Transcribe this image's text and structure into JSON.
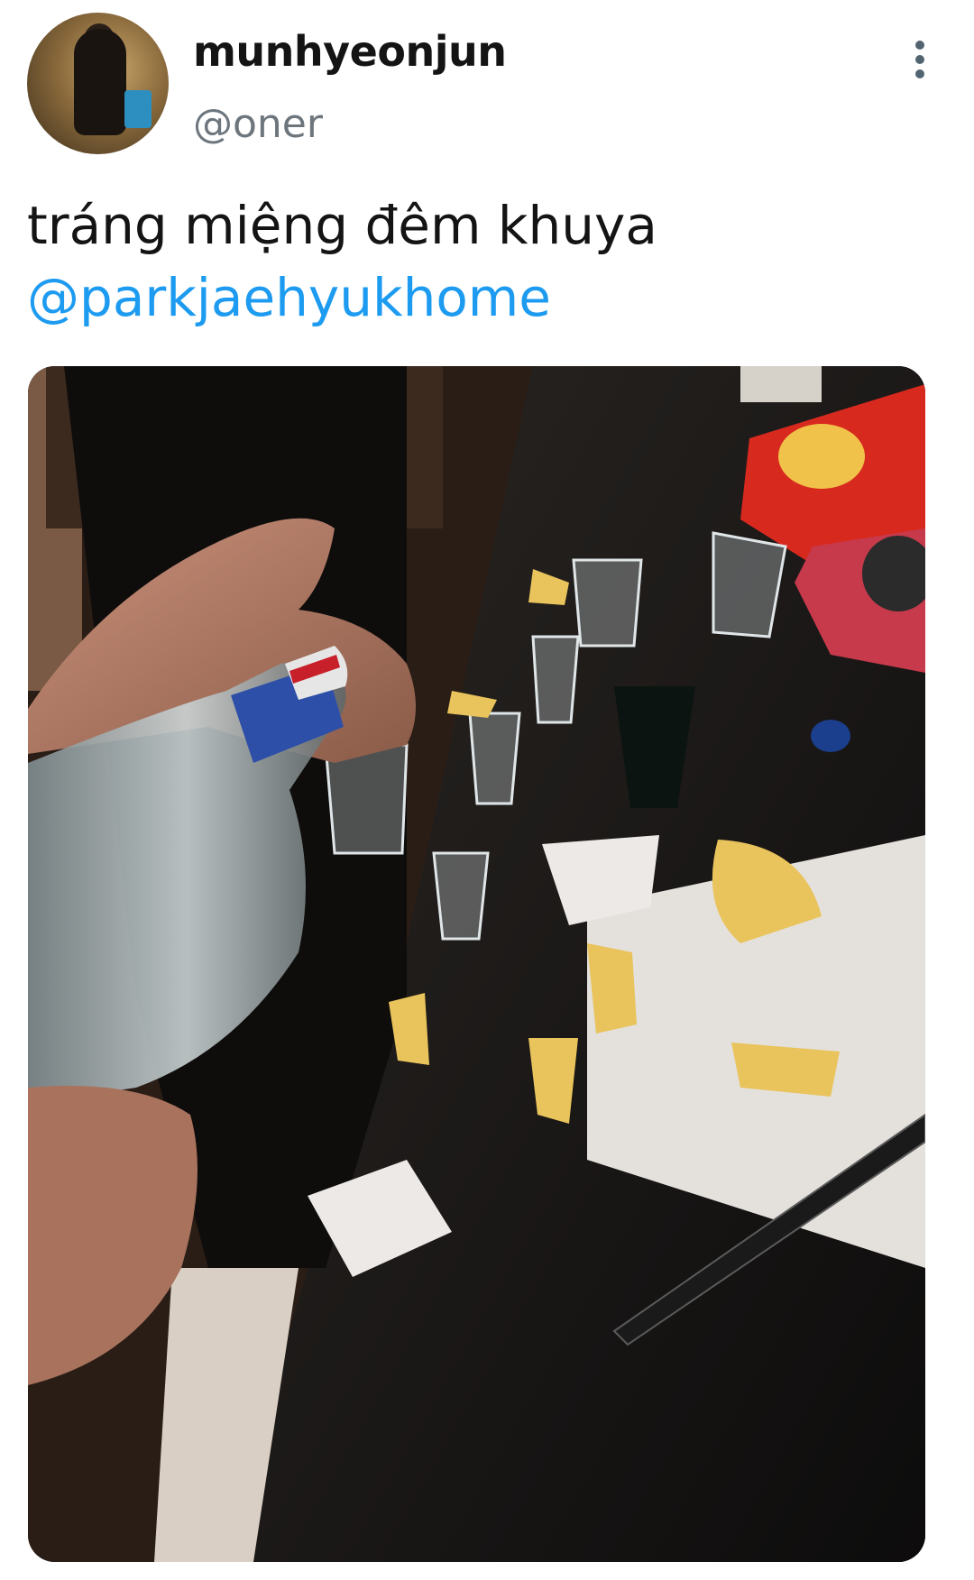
{
  "author": {
    "display_name": "munhyeonjun",
    "handle": "@oner",
    "avatar_icon": "profile-avatar"
  },
  "tweet": {
    "text_line": "tráng miệng đêm khuya",
    "mention": "@parkjaehyukhome"
  },
  "media": {
    "alt": "photo"
  },
  "icons": {
    "more": "more-vertical-icon"
  },
  "colors": {
    "link": "#1d9bf0",
    "handle_gray": "#6e767d"
  }
}
